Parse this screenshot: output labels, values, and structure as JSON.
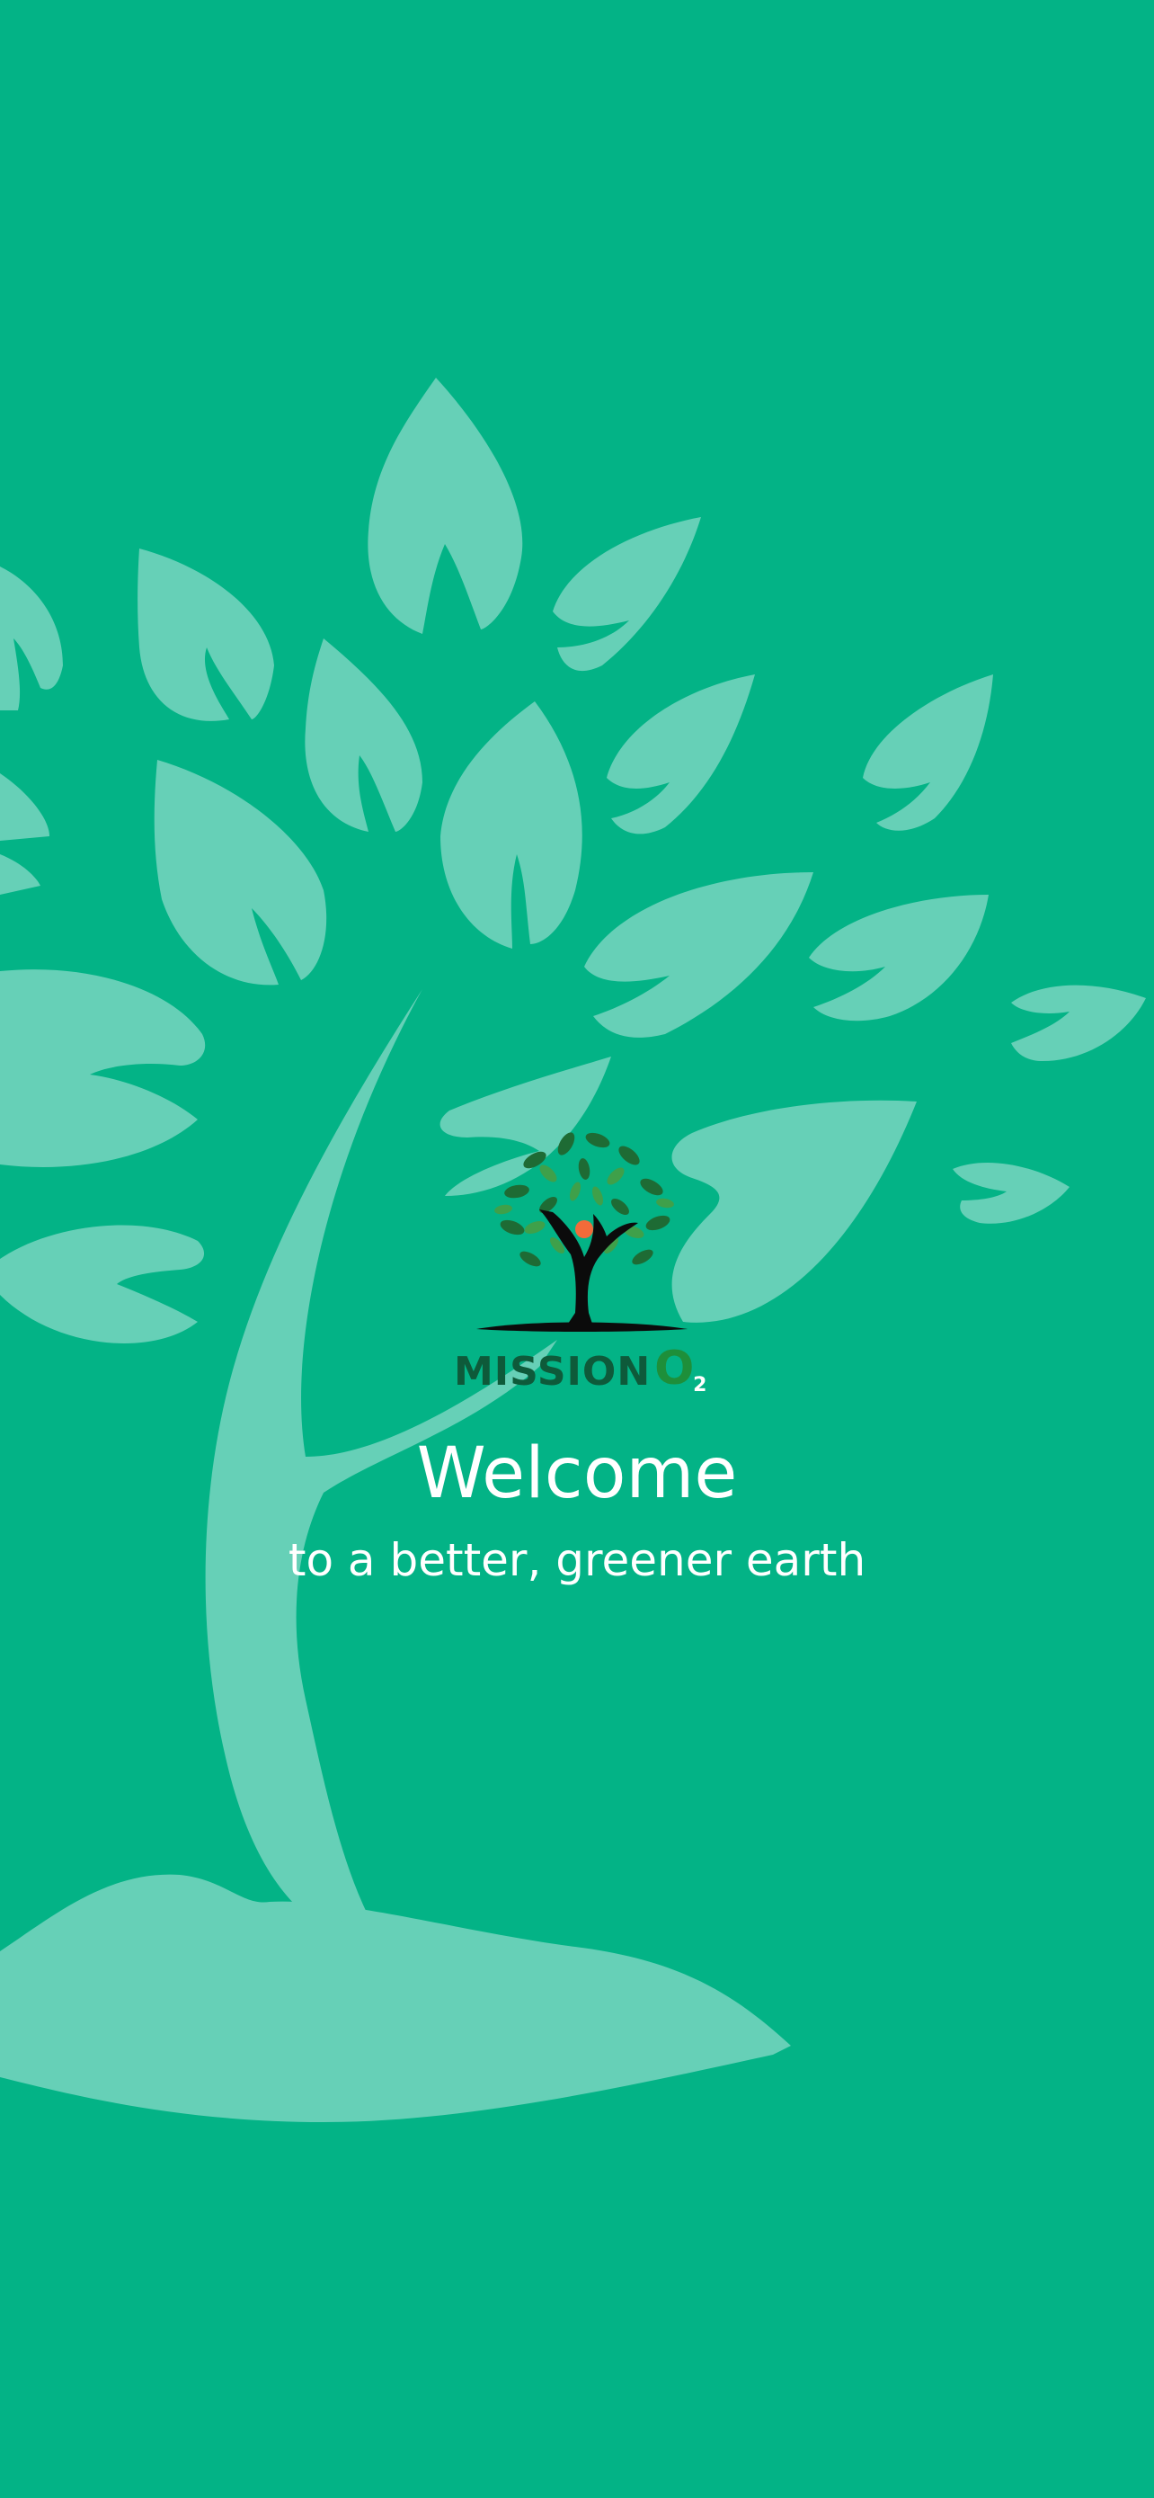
{
  "screen": {
    "name": "welcome",
    "background_color": "#03B386",
    "illustration_color": "#66D0B7"
  },
  "logo": {
    "word": "MISSION",
    "o_letter": "O",
    "subscript": "2",
    "icon": "tree-hands-icon",
    "colors": {
      "wordmark": "#0E5A3A",
      "o_letter": "#1E8F3A",
      "leaves_dark": "#1E6B34",
      "leaves_light": "#3FA04A",
      "fruit": "#F26B3A",
      "hands": "#0B0B0B"
    }
  },
  "welcome": {
    "title": "Welcome",
    "subtitle": "to a better, greener earth"
  }
}
